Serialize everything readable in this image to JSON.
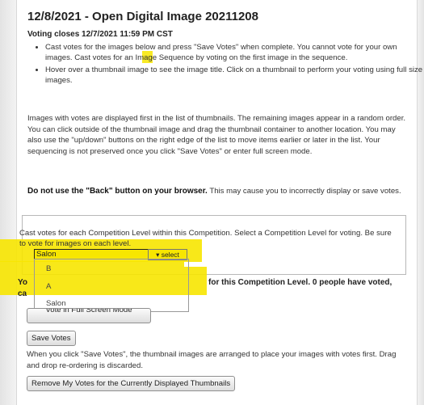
{
  "header": {
    "title": "12/8/2021 - Open Digital Image 20211208",
    "voting_closes": "Voting closes 12/7/2021 11:59 PM CST"
  },
  "instructions": {
    "bullets": [
      "Cast votes for the images below and press \"Save Votes\" when complete. You cannot vote for your own images. Cast votes for an Image Sequence by voting on the first image in the sequence.",
      "Hover over a thumbnail image to see the image title. Click on a thumbnail to perform your voting using full size images."
    ],
    "ordering_paragraph": "Images with votes are displayed first in the list of thumbnails. The remaining images appear in a random order. You can click outside of the thumbnail image and drag the thumbnail container to another location. You may also use the \"up/down\" buttons on the right edge of the list to move items earlier or later in the list. Your sequencing is not preserved once you click \"Save Votes\" or enter full screen mode.",
    "back_warning_bold": "Do not use the \"Back\" button on your browser.",
    "back_warning_rest": " This may cause you to incorrectly display or save votes."
  },
  "competition_level": {
    "description": "Cast votes for each Competition Level within this Competition. Select a Competition Level for voting. Be sure to vote for images on each level.",
    "selected": "Salon",
    "select_button": "▾ select",
    "options": [
      "B",
      "A",
      "Salon"
    ]
  },
  "status": {
    "left_line1": "Yo",
    "left_line2": "ca",
    "right": "for this Competition Level. 0 people have voted,"
  },
  "buttons": {
    "full_screen": "Vote in Full Screen Mode",
    "save_votes": "Save Votes",
    "remove_votes": "Remove My Votes for the Currently Displayed Thumbnails"
  },
  "save_note": "When you click \"Save Votes\", the thumbnail images are arranged to place your images with votes first. Drag and drop re-ordering is discarded.",
  "colors": {
    "highlight": "#f7e600",
    "panel_border": "#d8d8d8"
  }
}
